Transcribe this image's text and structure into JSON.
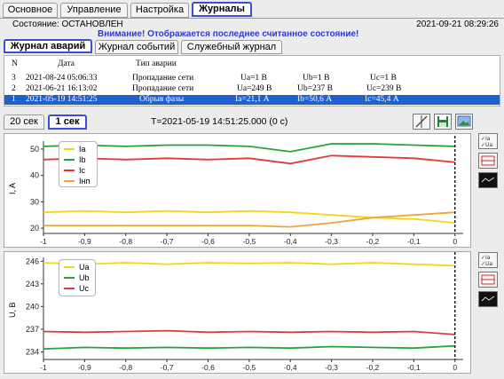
{
  "tabs": [
    "Основное",
    "Управление",
    "Настройка",
    "Журналы"
  ],
  "status": {
    "label": "Состояние: ОСТАНОВЛЕН",
    "datetime": "2021-09-21 08:29:26",
    "warning": "Внимание! Отображается последнее считанное состояние!"
  },
  "subtabs": [
    "Журнал аварий",
    "Журнал событий",
    "Служебный журнал"
  ],
  "table": {
    "headers": [
      "N",
      "Дата",
      "Тип аварии"
    ],
    "rows": [
      {
        "n": "3",
        "date": "2021-08-24 05:06:33",
        "type": "Пропадание сети",
        "v1": "Ua=1 В",
        "v2": "Ub=1 В",
        "v3": "Uc=1 В"
      },
      {
        "n": "2",
        "date": "2021-06-21 16:13:02",
        "type": "Пропадание сети",
        "v1": "Ua=249 В",
        "v2": "Ub=237 В",
        "v3": "Uc=239 В"
      },
      {
        "n": "1",
        "date": "2021-05-19 14:51:25",
        "type": "Обрыв фазы",
        "v1": "Ia=21,1 А",
        "v2": "Ib=50,6 А",
        "v3": "Ic=45,4 А"
      }
    ]
  },
  "timeframe": {
    "btn20": "20 сек",
    "btn1": "1 сек",
    "title": "T=2021-05-19 14:51:25.000 (0 с)"
  },
  "side_buttons": {
    "toggle": "Ia\nUa"
  },
  "colors": {
    "a": "#f2d619",
    "b": "#27a33a",
    "c": "#e23a3a",
    "n": "#f0a53a",
    "accent": "#3a4fd6",
    "sel": "#1f5fcf"
  },
  "chart_data": [
    {
      "type": "line",
      "ylabel": "I, A",
      "xlim": [
        -1,
        0.02
      ],
      "ylim": [
        18,
        53
      ],
      "x_ticks": [
        "-1",
        "-0,9",
        "-0,8",
        "-0,7",
        "-0,6",
        "-0,5",
        "-0,4",
        "-0,3",
        "-0,2",
        "-0,1",
        "0"
      ],
      "y_ticks": [
        20,
        30,
        40,
        50
      ],
      "series": [
        {
          "name": "Ia",
          "x": [
            -1,
            -0.9,
            -0.8,
            -0.7,
            -0.6,
            -0.5,
            -0.4,
            -0.3,
            -0.2,
            -0.1,
            0
          ],
          "values": [
            26,
            26.5,
            26,
            26.5,
            26,
            26.5,
            26,
            25,
            24,
            23.5,
            22
          ]
        },
        {
          "name": "Ib",
          "x": [
            -1,
            -0.9,
            -0.8,
            -0.7,
            -0.6,
            -0.5,
            -0.4,
            -0.3,
            -0.2,
            -0.1,
            0
          ],
          "values": [
            51,
            51.5,
            51,
            51.5,
            51.5,
            51,
            49,
            52,
            52,
            51.5,
            51
          ]
        },
        {
          "name": "Ic",
          "x": [
            -1,
            -0.9,
            -0.8,
            -0.7,
            -0.6,
            -0.5,
            -0.4,
            -0.3,
            -0.2,
            -0.1,
            0
          ],
          "values": [
            46,
            46.5,
            46,
            46.5,
            46,
            46.5,
            44.5,
            47.5,
            47,
            46.5,
            45
          ]
        },
        {
          "name": "Iнп",
          "x": [
            -1,
            -0.9,
            -0.8,
            -0.7,
            -0.6,
            -0.5,
            -0.4,
            -0.3,
            -0.2,
            -0.1,
            0
          ],
          "values": [
            21,
            21,
            21,
            21,
            21,
            21,
            20.5,
            22,
            24,
            25,
            26
          ]
        }
      ]
    },
    {
      "type": "line",
      "ylabel": "U, B",
      "xlim": [
        -1,
        0.02
      ],
      "ylim": [
        233,
        246.5
      ],
      "x_ticks": [
        "-1",
        "-0,9",
        "-0,8",
        "-0,7",
        "-0,6",
        "-0,5",
        "-0,4",
        "-0,3",
        "-0,2",
        "-0,1",
        "0"
      ],
      "y_ticks": [
        234,
        237,
        240,
        243,
        246
      ],
      "series": [
        {
          "name": "Ua",
          "x": [
            -1,
            -0.9,
            -0.8,
            -0.7,
            -0.6,
            -0.5,
            -0.4,
            -0.3,
            -0.2,
            -0.1,
            0
          ],
          "values": [
            245.8,
            245.6,
            245.8,
            245.6,
            245.8,
            245.7,
            245.8,
            245.6,
            245.8,
            245.6,
            245.4
          ]
        },
        {
          "name": "Ub",
          "x": [
            -1,
            -0.9,
            -0.8,
            -0.7,
            -0.6,
            -0.5,
            -0.4,
            -0.3,
            -0.2,
            -0.1,
            0
          ],
          "values": [
            234.4,
            234.6,
            234.5,
            234.6,
            234.5,
            234.6,
            234.5,
            234.7,
            234.6,
            234.5,
            234.8
          ]
        },
        {
          "name": "Uc",
          "x": [
            -1,
            -0.9,
            -0.8,
            -0.7,
            -0.6,
            -0.5,
            -0.4,
            -0.3,
            -0.2,
            -0.1,
            0
          ],
          "values": [
            236.7,
            236.6,
            236.7,
            236.8,
            236.6,
            236.7,
            236.6,
            236.7,
            236.6,
            236.7,
            236.3
          ]
        }
      ]
    }
  ]
}
